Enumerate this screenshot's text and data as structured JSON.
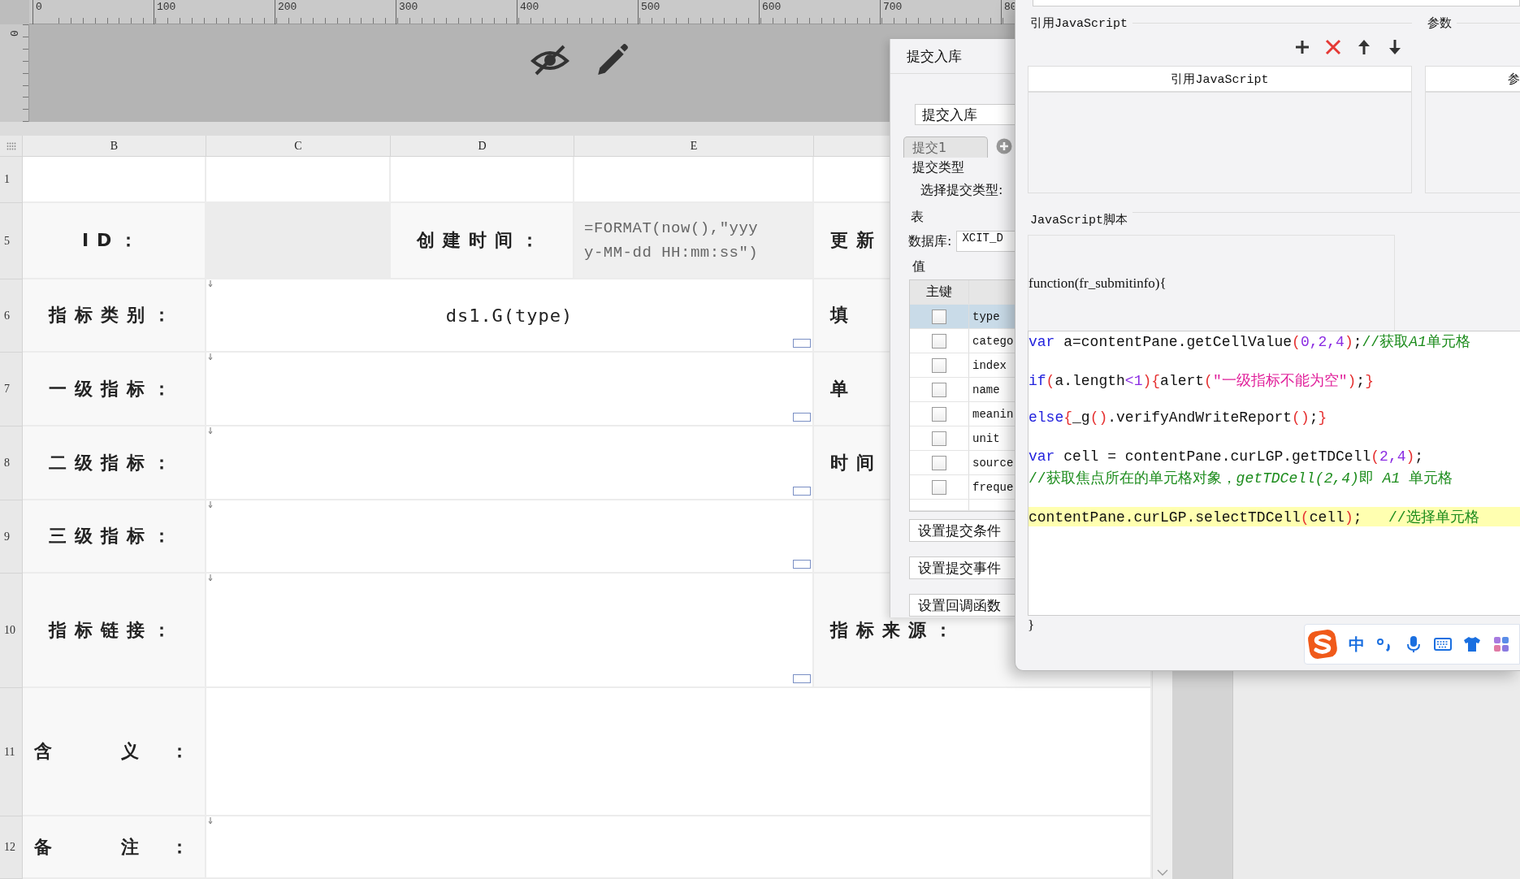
{
  "ruler": {
    "labels": [
      "0",
      "100",
      "200",
      "300",
      "400",
      "500",
      "600",
      "700",
      "80"
    ],
    "vertical_label": "0"
  },
  "sheet": {
    "columns": [
      "B",
      "C",
      "D",
      "E"
    ],
    "rows": [
      {
        "number": "1",
        "kind": "blank"
      },
      {
        "number": "5",
        "kind": "meta",
        "label": "ID：",
        "label_2": "创建时间：",
        "formula": "=FORMAT(now(),\"yyyy-MM-dd HH:mm:ss\")",
        "side_label": "更新"
      },
      {
        "number": "6",
        "kind": "field",
        "label": "指标类别：",
        "value": "ds1.G(type)",
        "side_label": "填"
      },
      {
        "number": "7",
        "kind": "field",
        "label": "一级指标：",
        "side_label": "单"
      },
      {
        "number": "8",
        "kind": "field",
        "label": "二级指标：",
        "side_label": "时间"
      },
      {
        "number": "9",
        "kind": "field",
        "label": "三级指标："
      },
      {
        "number": "10",
        "kind": "field",
        "label": "指标链接：",
        "side_label": "指标来源："
      },
      {
        "number": "11",
        "kind": "wide",
        "label": "含 义："
      },
      {
        "number": "12",
        "kind": "note",
        "label": "备 注："
      }
    ]
  },
  "submit_dialog": {
    "title": "提交入库",
    "type_select": "提交入库",
    "tabs": [
      {
        "label": "提交1",
        "selected": true
      }
    ],
    "group_type": "提交类型",
    "type_label": "选择提交类型:",
    "group_table": "表",
    "db_label": "数据库:",
    "db_value": "XCIT_D",
    "group_values": "值",
    "key_column": "主键",
    "fields": [
      {
        "name": "type",
        "key": false,
        "selected": true
      },
      {
        "name": "catego",
        "key": false,
        "selected": false
      },
      {
        "name": "index",
        "key": false,
        "selected": false
      },
      {
        "name": "name",
        "key": false,
        "selected": false
      },
      {
        "name": "meanin",
        "key": false,
        "selected": false
      },
      {
        "name": "unit",
        "key": false,
        "selected": false
      },
      {
        "name": "source",
        "key": false,
        "selected": false
      },
      {
        "name": "freque",
        "key": false,
        "selected": false
      }
    ],
    "buttons": [
      "设置提交条件",
      "设置提交事件",
      "设置回调函数"
    ]
  },
  "js_dialog": {
    "ref_group": "引用JavaScript",
    "param_group": "参数",
    "ref_header": "引用JavaScript",
    "param_header": "参",
    "script_group": "JavaScript脚本",
    "signature": "function(fr_submitinfo){",
    "lines": [
      {
        "kind": "code",
        "highlighted": false,
        "tokens": [
          {
            "text": "var",
            "kind": "keyword"
          },
          {
            "text": " a=contentPane.getCellValue",
            "kind": "plain"
          },
          {
            "text": "(",
            "kind": "paren"
          },
          {
            "text": "0,2,4",
            "kind": "number"
          },
          {
            "text": ")",
            "kind": "paren"
          },
          {
            "text": ";",
            "kind": "plain"
          },
          {
            "text": "//获取",
            "kind": "comment"
          },
          {
            "text": "A1",
            "kind": "comment_italic"
          },
          {
            "text": "单元格",
            "kind": "comment"
          }
        ]
      },
      {
        "kind": "blank"
      },
      {
        "kind": "code",
        "highlighted": false,
        "tokens": [
          {
            "text": "if",
            "kind": "keyword"
          },
          {
            "text": "(",
            "kind": "paren"
          },
          {
            "text": "a.length",
            "kind": "plain"
          },
          {
            "text": "<1",
            "kind": "number"
          },
          {
            "text": ")",
            "kind": "paren"
          },
          {
            "text": "{",
            "kind": "paren"
          },
          {
            "text": "alert",
            "kind": "plain"
          },
          {
            "text": "(",
            "kind": "paren"
          },
          {
            "text": "\"一级指标不能为空\"",
            "kind": "string"
          },
          {
            "text": ")",
            "kind": "paren"
          },
          {
            "text": ";",
            "kind": "plain"
          },
          {
            "text": "}",
            "kind": "paren"
          }
        ]
      },
      {
        "kind": "blank"
      },
      {
        "kind": "code",
        "highlighted": false,
        "tokens": [
          {
            "text": "else",
            "kind": "keyword"
          },
          {
            "text": "{",
            "kind": "paren"
          },
          {
            "text": "_g",
            "kind": "plain"
          },
          {
            "text": "()",
            "kind": "paren"
          },
          {
            "text": ".verifyAndWriteReport",
            "kind": "plain"
          },
          {
            "text": "()",
            "kind": "paren"
          },
          {
            "text": ";",
            "kind": "plain"
          },
          {
            "text": "}",
            "kind": "paren"
          }
        ]
      },
      {
        "kind": "blank"
      },
      {
        "kind": "code",
        "highlighted": false,
        "tokens": [
          {
            "text": "var",
            "kind": "keyword"
          },
          {
            "text": " cell = contentPane.curLGP.getTDCell",
            "kind": "plain"
          },
          {
            "text": "(",
            "kind": "paren"
          },
          {
            "text": "2,4",
            "kind": "number"
          },
          {
            "text": ")",
            "kind": "paren"
          },
          {
            "text": ";",
            "kind": "plain"
          }
        ]
      },
      {
        "kind": "code",
        "highlighted": false,
        "tokens": [
          {
            "text": "//获取焦点所在的单元格对象，",
            "kind": "comment"
          },
          {
            "text": "getTDCell(2,4)",
            "kind": "comment_italic"
          },
          {
            "text": "即 ",
            "kind": "comment"
          },
          {
            "text": "A1",
            "kind": "comment_italic"
          },
          {
            "text": " 单元格",
            "kind": "comment"
          }
        ]
      },
      {
        "kind": "blank"
      },
      {
        "kind": "code",
        "highlighted": true,
        "tokens": [
          {
            "text": "contentPane.curLGP.selectTDCell",
            "kind": "plain"
          },
          {
            "text": "(",
            "kind": "paren"
          },
          {
            "text": "cell",
            "kind": "plain"
          },
          {
            "text": ")",
            "kind": "paren"
          },
          {
            "text": ";   ",
            "kind": "plain"
          },
          {
            "text": "//选择单元格",
            "kind": "comment"
          }
        ]
      }
    ],
    "closing": "}"
  },
  "ime": {
    "mode": "中"
  }
}
